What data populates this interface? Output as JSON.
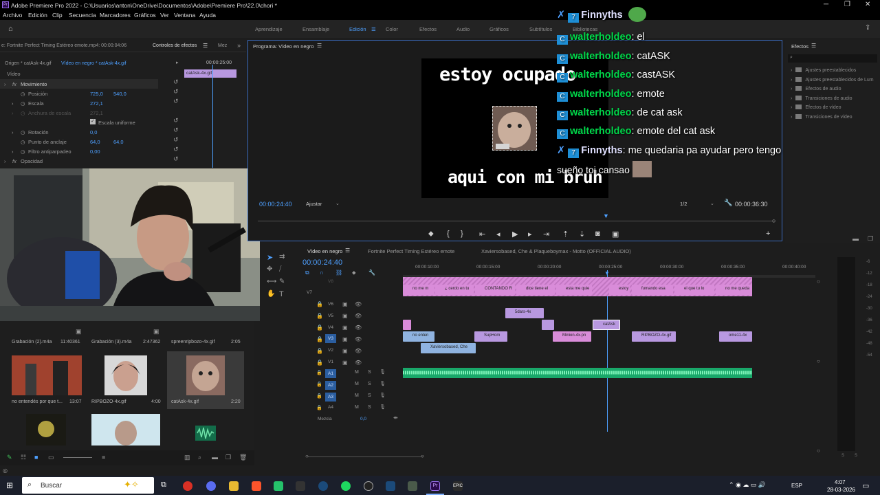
{
  "window": {
    "title": "Adobe Premiere Pro 2022 - C:\\Usuarios\\anton\\OneDrive\\Documentos\\Adobe\\Premiere Pro\\22.0\\chori *",
    "minimize": "─",
    "restore": "❐",
    "close": "✕"
  },
  "menu": [
    "Archivo",
    "Edición",
    "Clip",
    "Secuencia",
    "Marcadores",
    "Gráficos",
    "Ver",
    "Ventana",
    "Ayuda"
  ],
  "workspaces": {
    "items": [
      "Aprendizaje",
      "Ensamblaje",
      "Edición",
      "Color",
      "Efectos",
      "Audio",
      "Gráficos",
      "Subtítulos",
      "Bibliotecas"
    ],
    "active": "Edición"
  },
  "source_panel": {
    "tab_source": "e: Fortnite Perfect Timing Estéreo emote.mp4: 00:00:04:06",
    "tab_effects": "Controles de efectos",
    "tab_more": "Mez",
    "origin": "Origen * catAsk-4x.gif",
    "target": "Vídeo en negro * catAsk-4x.gif",
    "timecode": "00:00:25:00",
    "clip": "catAsk-4x.gif",
    "section": "Vídeo",
    "props": [
      {
        "label": "Movimiento"
      },
      {
        "label": "Posición",
        "v1": "725,0",
        "v2": "540,0"
      },
      {
        "label": "Escala",
        "v1": "272,1"
      },
      {
        "label": "Anchura de escala",
        "v1": "272,1"
      },
      {
        "label": "Escala uniforme"
      },
      {
        "label": "Rotación",
        "v1": "0,0"
      },
      {
        "label": "Punto de anclaje",
        "v1": "64,0",
        "v2": "64,0"
      },
      {
        "label": "Filtro antiparpadeo",
        "v1": "0,00"
      },
      {
        "label": "Opacidad"
      }
    ]
  },
  "program": {
    "tab": "Programa: Vídeo en negro",
    "video_top_text": "estoy ocupado",
    "video_bottom_text": "aqui con mi bruh",
    "timecode_left": "00:00:24:40",
    "fit": "Ajustar",
    "resolution": "1/2",
    "timecode_right": "00:00:36:30"
  },
  "chat": [
    {
      "user": "Finnyths",
      "badge": true,
      "msg": ""
    },
    {
      "user": "walterholdeo",
      "msg": "el"
    },
    {
      "user": "walterholdeo",
      "msg": "catASK"
    },
    {
      "user": "walterholdeo",
      "msg": "castASK"
    },
    {
      "user": "walterholdeo",
      "msg": "emote"
    },
    {
      "user": "walterholdeo",
      "msg": "de cat ask"
    },
    {
      "user": "walterholdeo",
      "msg": "emote del cat ask"
    },
    {
      "user": "Finnyths",
      "badge": true,
      "msg": "me quedaria pa ayudar pero tengo"
    },
    {
      "msg": "sueño toi cansao"
    }
  ],
  "effects": {
    "tab": "Efectos",
    "items": [
      "Ajustes preestablecidos",
      "Ajustes preestablecidos de Lum",
      "Efectos de audio",
      "Transiciones de audio",
      "Efectos de vídeo",
      "Transiciones de vídeo"
    ]
  },
  "timeline": {
    "tabs": [
      "Vídeo en negro",
      "Fortnite Perfect Timing Estéreo emote",
      "Xaviersobased, Che & Plaqueboymax - Motto (OFFICIAL AUDIO)"
    ],
    "timecode": "00:00:24:40",
    "ruler": [
      "00:00:10:00",
      "00:00:15:00",
      "00:00:20:00",
      "00:00:25:00",
      "00:00:30:00",
      "00:00:35:00",
      "00:00:40:00"
    ],
    "video_tracks": [
      "V8",
      "V7",
      "V6",
      "V5",
      "V4",
      "V3",
      "V2",
      "V1"
    ],
    "audio_tracks": [
      "A1",
      "A2",
      "A3",
      "A4"
    ],
    "mix": "Mezcla",
    "mix_value": "0,0",
    "clips_v7": [
      "no me m",
      "¿ cerdo en tu",
      "CONTANDO R",
      "dice tiene el",
      "esta me quie",
      "estoy",
      "fumando esa",
      "el que tu lo",
      "no me queda"
    ],
    "clip_v5": "5dars-4x",
    "clip_v4": "catAsk",
    "clips_v3": [
      "no enten",
      "SupHom",
      "Minion-4x.pn",
      "RIPBOZO-4x.gif",
      "ome11-4x"
    ],
    "clip_v2": "Xaviersobased, Che"
  },
  "project": {
    "items": [
      {
        "name": "Grabación (2).m4a",
        "dur": "11:40361"
      },
      {
        "name": "Grabación (3).m4a",
        "dur": "2:47362"
      },
      {
        "name": "spreenripbozo-4x.gif",
        "dur": "2:05"
      },
      {
        "name": "no entendés por que t...",
        "dur": "13:07"
      },
      {
        "name": "RIPBOZO-4x.gif",
        "dur": "4:00"
      },
      {
        "name": "catAsk-4x.gif",
        "dur": "2:20"
      }
    ]
  },
  "meters": [
    "-6",
    "-12",
    "-18",
    "-24",
    "-30",
    "-36",
    "-42",
    "-48",
    "-54"
  ],
  "taskbar": {
    "search": "Buscar",
    "lang": "ESP",
    "time": "4:07",
    "date": "28-03-2026"
  },
  "colors": {
    "accent": "#4ea0ff",
    "pink_clip": "#d98cd9",
    "audio_clip": "#19a86a",
    "chat_name": "#00d84a"
  }
}
